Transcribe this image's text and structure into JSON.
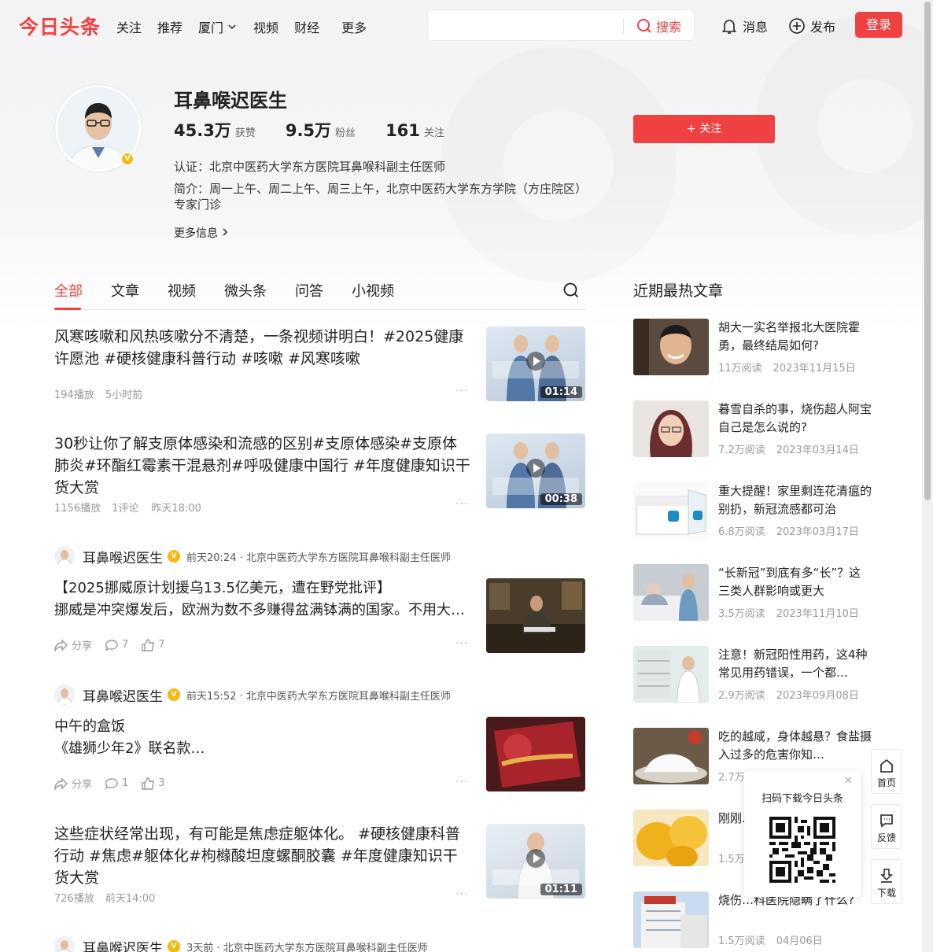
{
  "header": {
    "logo": "今日头条",
    "nav": [
      "关注",
      "推荐",
      "厦门",
      "视频",
      "财经",
      "更多"
    ],
    "search_placeholder": "",
    "search_label": "搜索",
    "messages": "消息",
    "publish": "发布",
    "login": "登录"
  },
  "profile": {
    "name": "耳鼻喉迟医生",
    "likes_num": "45.3万",
    "likes_lbl": "获赞",
    "fans_num": "9.5万",
    "fans_lbl": "粉丝",
    "follow_num": "161",
    "follow_lbl": "关注",
    "cert": "认证：北京中医药大学东方医院耳鼻喉科副主任医师",
    "intro": "简介：周一上午、周二上午、周三上午，北京中医药大学东方学院（方庄院区）专家门诊",
    "more": "更多信息",
    "follow_btn": "+ 关注",
    "verified": "V"
  },
  "tabs": [
    "全部",
    "文章",
    "视频",
    "微头条",
    "问答",
    "小视频"
  ],
  "feed": [
    {
      "title": "风寒咳嗽和风热咳嗽分不清楚，一条视频讲明白！#2025健康许愿池 #硬核健康科普行动 #咳嗽 #风寒咳嗽",
      "plays": "194播放",
      "time": "5小时前",
      "duration": "01:14"
    },
    {
      "title": "30秒让你了解支原体感染和流感的区别#支原体感染#支原体肺炎#环酯红霉素干混悬剂#呼吸健康中国行 #年度健康知识干货大赏",
      "plays": "1156播放",
      "comments": "1评论",
      "time": "昨天18:00",
      "duration": "00:38"
    },
    {
      "author": "耳鼻喉迟医生",
      "meta": "前天20:24 · 北京中医药大学东方医院耳鼻喉科副主任医师",
      "line1": "【2025挪威原计划援乌13.5亿美元，遭在野党批评】",
      "line2": "挪威是冲突爆发后，欧洲为数不多赚得盆满钵满的国家。不用大…",
      "share": "分享",
      "comments": "7",
      "likes": "7"
    },
    {
      "author": "耳鼻喉迟医生",
      "meta": "前天15:52 · 北京中医药大学东方医院耳鼻喉科副主任医师",
      "line1": "中午的盒饭",
      "line2": "《雄狮少年2》联名款…",
      "share": "分享",
      "comments": "1",
      "likes": "3"
    },
    {
      "title": "这些症状经常出现，有可能是焦虑症躯体化。 #硬核健康科普行动 #焦虑#躯体化#枸橼酸坦度螺酮胶囊 #年度健康知识干货大赏",
      "plays": "726播放",
      "time": "前天14:00",
      "duration": "01:11"
    },
    {
      "author": "耳鼻喉迟医生",
      "meta": "3天前 · 北京中医药大学东方医院耳鼻喉科副主任医师"
    }
  ],
  "hot": {
    "heading": "近期最热文章",
    "items": [
      {
        "title": "胡大一实名举报北大医院霍勇，最终结局如何?",
        "reads": "11万阅读",
        "date": "2023年11月15日"
      },
      {
        "title": "暮雪自杀的事，烧伤超人阿宝自己是怎么说的?",
        "reads": "7.2万阅读",
        "date": "2023年03月14日"
      },
      {
        "title": "重大提醒！家里剩连花清瘟的别扔，新冠流感都可治",
        "reads": "6.8万阅读",
        "date": "2023年03月17日"
      },
      {
        "title": "“长新冠”到底有多“长”？这三类人群影响或更大",
        "reads": "3.5万阅读",
        "date": "2023年11月10日"
      },
      {
        "title": "注意！新冠阳性用药，这4种常见用药错误，一个都…",
        "reads": "2.9万阅读",
        "date": "2023年09月08日"
      },
      {
        "title": "吃的越咸，身体越悬？食盐摄入过多的危害你知…",
        "reads": "2.7万",
        "date": ""
      },
      {
        "title": "刚刚…一些…",
        "reads": "1.5万",
        "date": ""
      },
      {
        "title": "烧伤…科医院隐瞒了什么?",
        "reads": "1.5万阅读",
        "date": "04月06日"
      }
    ]
  },
  "qr": {
    "text": "扫码下载今日头条",
    "close": "×"
  },
  "tools": {
    "home": "首页",
    "feedback": "反馈",
    "download": "下载"
  },
  "colors": {
    "accent": "#f04142",
    "badge": "#f5b90f"
  }
}
